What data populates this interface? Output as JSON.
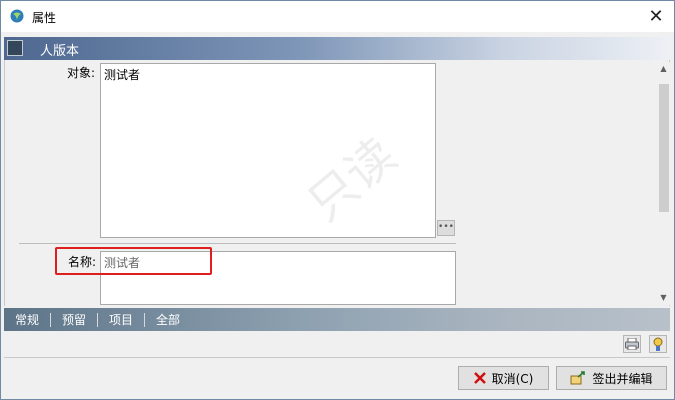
{
  "window": {
    "title": "属性",
    "close_glyph": "✕"
  },
  "header": {
    "title": "人版本"
  },
  "fields": {
    "object": {
      "label": "对象:",
      "value": "测试者",
      "ellipsis": "•••"
    },
    "name": {
      "label": "名称:",
      "value": "测试者"
    }
  },
  "tabs": [
    "常规",
    "预留",
    "项目",
    "全部"
  ],
  "buttons": {
    "cancel_label": "取消(C)",
    "checkout_label": "签出并编辑"
  },
  "colors": {
    "highlight": "#e01e1e",
    "cancel_icon": "#d01010"
  },
  "watermark": "只读"
}
